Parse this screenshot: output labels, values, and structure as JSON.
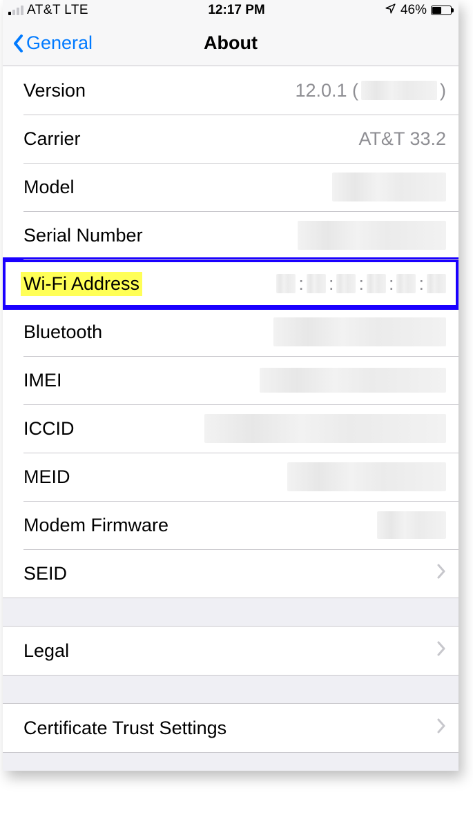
{
  "status_bar": {
    "carrier": "AT&T",
    "network_type": "LTE",
    "time": "12:17 PM",
    "battery_percent": "46%"
  },
  "nav": {
    "back_label": "General",
    "title": "About"
  },
  "rows": {
    "version": {
      "label": "Version",
      "prefix": "12.0.1 (",
      "suffix": ")"
    },
    "carrier": {
      "label": "Carrier",
      "value": "AT&T 33.2"
    },
    "model": {
      "label": "Model"
    },
    "serial": {
      "label": "Serial Number"
    },
    "wifi": {
      "label": "Wi-Fi Address"
    },
    "bluetooth": {
      "label": "Bluetooth"
    },
    "imei": {
      "label": "IMEI"
    },
    "iccid": {
      "label": "ICCID"
    },
    "meid": {
      "label": "MEID"
    },
    "modem": {
      "label": "Modem Firmware"
    },
    "seid": {
      "label": "SEID"
    },
    "legal": {
      "label": "Legal"
    },
    "cert": {
      "label": "Certificate Trust Settings"
    }
  }
}
